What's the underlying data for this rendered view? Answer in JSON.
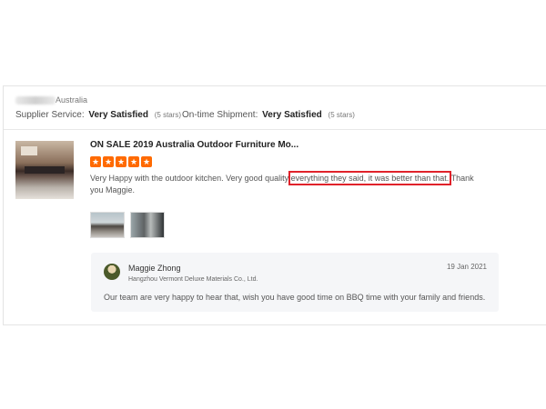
{
  "buyer": {
    "country": "Australia"
  },
  "ratings": [
    {
      "label": "Supplier Service:",
      "value": "Very Satisfied",
      "detail": "(5 stars)"
    },
    {
      "label": "On-time Shipment:",
      "value": "Very Satisfied",
      "detail": "(5 stars)"
    }
  ],
  "product": {
    "title": "ON SALE 2019 Australia Outdoor Furniture Mo..."
  },
  "review": {
    "stars": 5,
    "text_before": "Very Happy with the outdoor kitchen. Very good quality ",
    "highlighted": "everything they said, it was better than that.",
    "text_after": " Thank you Maggie.",
    "highlight_color": "#e0222a"
  },
  "colors": {
    "star": "#ff6a00",
    "reply_bg": "#f5f6f8"
  },
  "reply": {
    "name": "Maggie Zhong",
    "company": "Hangzhou Vermont Deluxe Materials Co., Ltd.",
    "date": "19 Jan 2021",
    "text": "Our team are very happy to hear that, wish you have good time on BBQ time with your family and friends."
  }
}
